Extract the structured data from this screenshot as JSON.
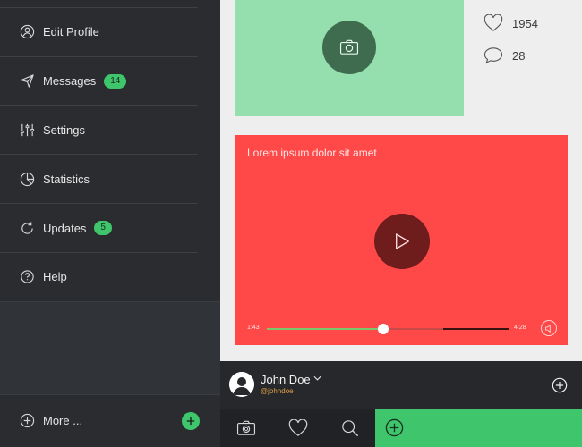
{
  "sidebar": {
    "items": [
      {
        "label": "Edit Profile",
        "icon": "user-icon"
      },
      {
        "label": "Messages",
        "icon": "send-icon",
        "badge": "14"
      },
      {
        "label": "Settings",
        "icon": "sliders-icon"
      },
      {
        "label": "Statistics",
        "icon": "pie-chart-icon"
      },
      {
        "label": "Updates",
        "icon": "refresh-icon",
        "badge": "5"
      },
      {
        "label": "Help",
        "icon": "help-icon"
      }
    ],
    "more_label": "More ...",
    "add_icon": "plus-icon"
  },
  "photo_card": {
    "icon": "camera-icon",
    "color": "#95dfae"
  },
  "stats": {
    "likes": "1954",
    "comments": "28"
  },
  "video": {
    "title": "Lorem ipsum dolor sit amet",
    "time_current": "1:43",
    "time_total": "4:28",
    "progress": 0.48,
    "buffered": 0.73,
    "color": "#ff4848"
  },
  "user": {
    "name": "John Doe",
    "handle": "@johndoe"
  },
  "tabs": [
    {
      "icon": "camera-icon"
    },
    {
      "icon": "heart-icon"
    },
    {
      "icon": "search-icon"
    },
    {
      "icon": "plus-circle-icon",
      "active": true
    }
  ],
  "colors": {
    "accent": "#3fc56b",
    "sidebar": "#2a2c2f"
  }
}
